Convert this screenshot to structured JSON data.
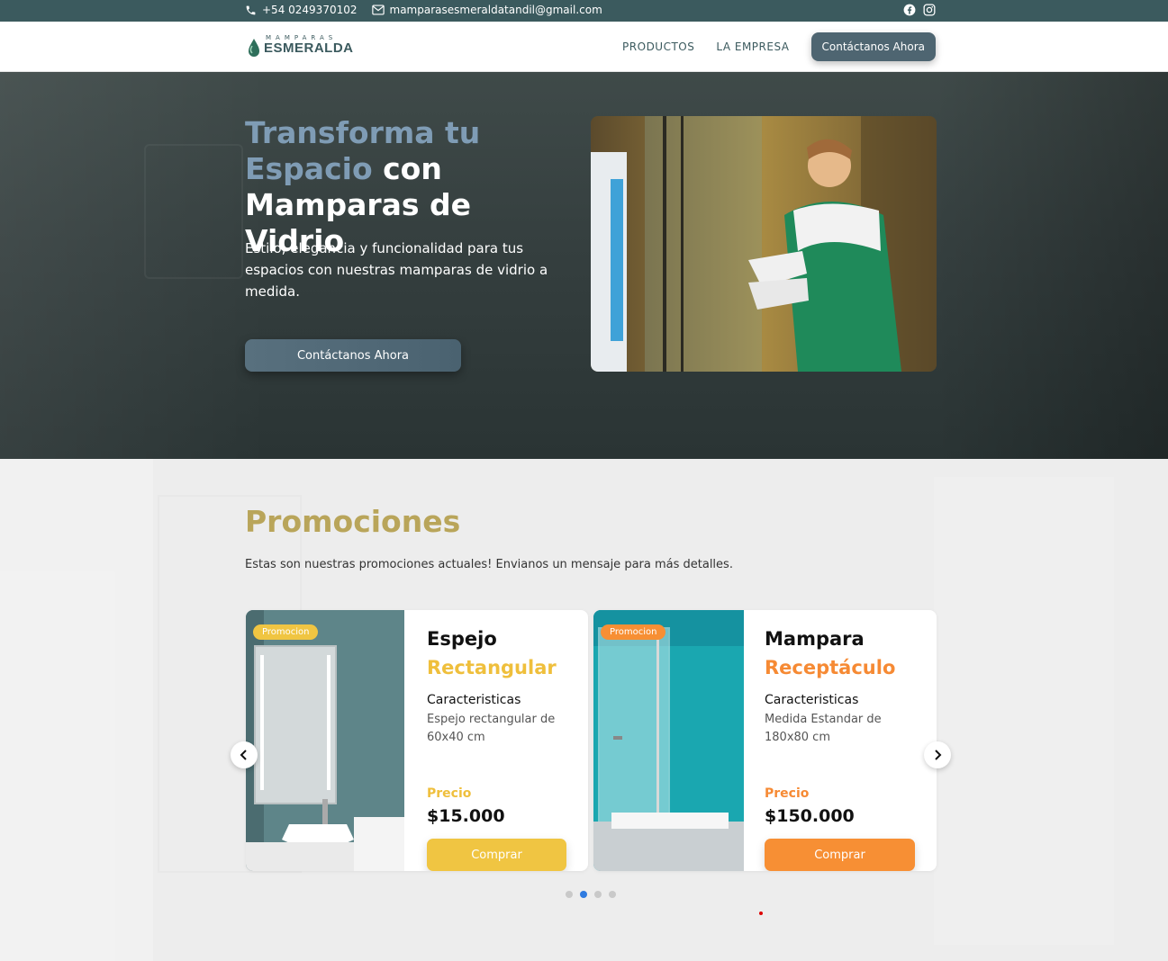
{
  "topbar": {
    "phone": "+54 0249370102",
    "email": "mamparasesmeraldatandil@gmail.com",
    "social": [
      "facebook-icon",
      "instagram-icon"
    ]
  },
  "nav": {
    "logo_small": "MAMPARAS",
    "logo_big": "ESMERALDA",
    "links": [
      "PRODUCTOS",
      "LA EMPRESA"
    ],
    "cta": "Contáctanos Ahora"
  },
  "hero": {
    "title_part1": "Transforma tu Espacio",
    "title_part2": " con Mamparas de Vidrio",
    "subtitle": "Estilo, elegancia y funcionalidad para tus espacios con nuestras mamparas de vidrio a medida.",
    "cta": "Contáctanos Ahora"
  },
  "promos": {
    "title": "Promociones",
    "description": "Estas son nuestras promociones actuales! Envianos un mensaje para más detalles.",
    "cards": [
      {
        "badge": "Promocion",
        "title1": "Espejo",
        "title2": "Rectangular",
        "features_label": "Caracteristicas",
        "features": "Espejo rectangular de 60x40 cm",
        "price_label": "Precio",
        "price": "$15.000",
        "buy": "Comprar"
      },
      {
        "badge": "Promocion",
        "title1": "Mampara",
        "title2": "Receptáculo",
        "features_label": "Caracteristicas",
        "features": "Medida Estandar de 180x80 cm",
        "price_label": "Precio",
        "price": "$150.000",
        "buy": "Comprar"
      }
    ],
    "dots_total": 4,
    "dots_active": 2
  },
  "colors": {
    "brand_dark": "#3b5a5e",
    "button": "#4e6571",
    "yellow": "#f0c542",
    "orange": "#f78f34",
    "promo_title": "#b9a55a"
  }
}
